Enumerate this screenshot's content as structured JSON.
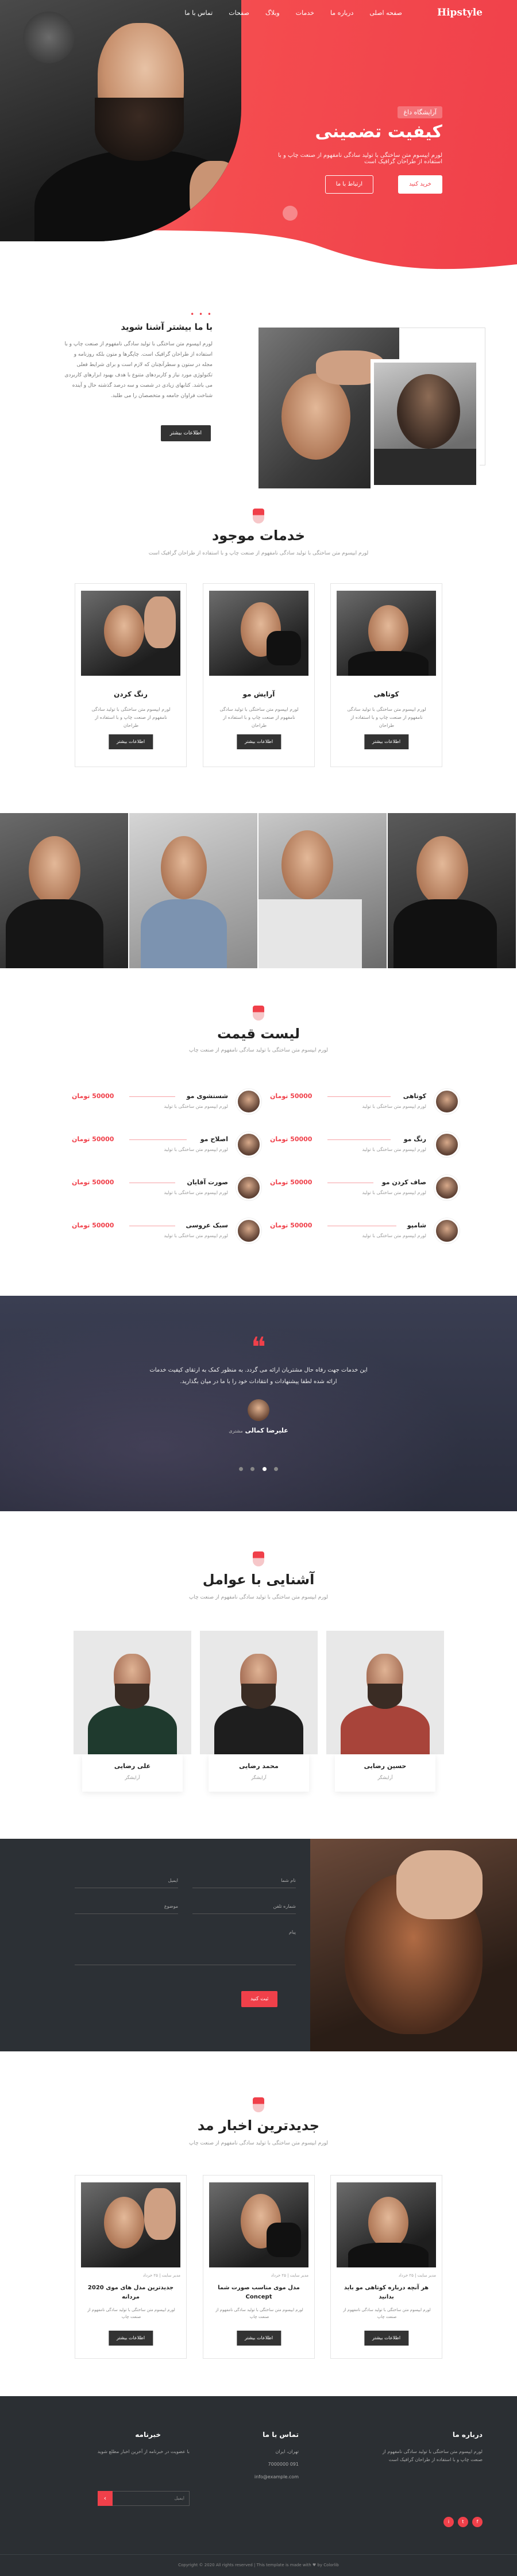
{
  "header": {
    "logo": "Hipstyle",
    "menu": [
      "صفحه اصلی",
      "درباره ما",
      "خدمات",
      "وبلاگ",
      "صفحات",
      "تماس با ما"
    ]
  },
  "hero": {
    "tag": "آرایشگاه داغ",
    "title": "کیفیت تضمینی",
    "subtitle": "لورم ایپسوم متن ساختگی با تولید سادگی نامفهوم از صنعت چاپ و با استفاده از طراحان گرافیک است",
    "button_primary": "خرید کنید",
    "button_secondary": "ارتباط با ما"
  },
  "about": {
    "title": "با ما بیشتر آشنا شوید",
    "text": "لورم ایپسوم متن ساختگی با تولید سادگی نامفهوم از صنعت چاپ و با استفاده از طراحان گرافیک است. چاپگرها و متون بلکه روزنامه و مجله در ستون و سطرآنچنان که لازم است و برای شرایط فعلی تکنولوژی مورد نیاز و کاربردهای متنوع با هدف بهبود ابزارهای کاربردی می باشد. کتابهای زیادی در شصت و سه درصد گذشته حال و آینده شناخت فراوان جامعه و متخصصان را می طلبد.",
    "button": "اطلاعات بیشتر"
  },
  "services": {
    "title": "خدمات موجود",
    "subtitle": "لورم ایپسوم متن ساختگی با تولید سادگی نامفهوم از صنعت چاپ و با استفاده از طراحان گرافیک است",
    "items": [
      {
        "name": "کوتاهی",
        "desc": "لورم ایپسوم متن ساختگی با تولید سادگی نامفهوم از صنعت چاپ و با استفاده از طراحان",
        "button": "اطلاعات بیشتر"
      },
      {
        "name": "آرایش مو",
        "desc": "لورم ایپسوم متن ساختگی با تولید سادگی نامفهوم از صنعت چاپ و با استفاده از طراحان",
        "button": "اطلاعات بیشتر"
      },
      {
        "name": "رنگ کردن",
        "desc": "لورم ایپسوم متن ساختگی با تولید سادگی نامفهوم از صنعت چاپ و با استفاده از طراحان",
        "button": "اطلاعات بیشتر"
      }
    ]
  },
  "prices": {
    "title": "لیست قیمت",
    "subtitle": "لورم ایپسوم متن ساختگی با تولید سادگی نامفهوم از صنعت چاپ",
    "right": [
      {
        "name": "کوتاهی",
        "price": "50000 تومان",
        "desc": "لورم ایپسوم متن ساختگی با تولید"
      },
      {
        "name": "رنگ مو",
        "price": "50000 تومان",
        "desc": "لورم ایپسوم متن ساختگی با تولید"
      },
      {
        "name": "صاف کردن مو",
        "price": "50000 تومان",
        "desc": "لورم ایپسوم متن ساختگی با تولید"
      },
      {
        "name": "شامپو",
        "price": "50000 تومان",
        "desc": "لورم ایپسوم متن ساختگی با تولید"
      }
    ],
    "left": [
      {
        "name": "شستشوی مو",
        "price": "50000 تومان",
        "desc": "لورم ایپسوم متن ساختگی با تولید"
      },
      {
        "name": "اصلاح مو",
        "price": "50000 تومان",
        "desc": "لورم ایپسوم متن ساختگی با تولید"
      },
      {
        "name": "صورت آقایان",
        "price": "50000 تومان",
        "desc": "لورم ایپسوم متن ساختگی با تولید"
      },
      {
        "name": "سبک عروسی",
        "price": "50000 تومان",
        "desc": "لورم ایپسوم متن ساختگی با تولید"
      }
    ]
  },
  "testimonial": {
    "quote_mark": "❝",
    "text": "این خدمات جهت رفاه حال مشتریان ارائه می گردد. به منظور کمک به ارتقای کیفیت خدمات ارائه شده لطفا پیشنهادات و انتقادات خود را با ما در میان بگذارید.",
    "name": "علیرضا کمالی",
    "role": "مشتری"
  },
  "team": {
    "title": "آشنایی با عوامل",
    "subtitle": "لورم ایپسوم متن ساختگی با تولید سادگی نامفهوم از صنعت چاپ",
    "members": [
      {
        "name": "حسین رضایی",
        "role": "آرایشگر"
      },
      {
        "name": "محمد رضایی",
        "role": "آرایشگر"
      },
      {
        "name": "علی رضایی",
        "role": "آرایشگر"
      }
    ]
  },
  "contact": {
    "fields": [
      "نام شما",
      "ایمیل",
      "شماره تلفن",
      "موضوع",
      "پیام"
    ],
    "button": "ثبت کنید"
  },
  "news": {
    "title": "جدیدترین اخبار مد",
    "subtitle": "لورم ایپسوم متن ساختگی با تولید سادگی نامفهوم از صنعت چاپ",
    "items": [
      {
        "meta": "مدیر سایت  |  ۲۵ خرداد",
        "title": "هر آنچه درباره کوتاهی مو باید بدانید",
        "desc": "لورم ایپسوم متن ساختگی با تولید سادگی نامفهوم از صنعت چاپ",
        "button": "اطلاعات بیشتر"
      },
      {
        "meta": "مدیر سایت  |  ۲۵ خرداد",
        "title": "مدل موی مناسب صورت شما Concept",
        "desc": "لورم ایپسوم متن ساختگی با تولید سادگی نامفهوم از صنعت چاپ",
        "button": "اطلاعات بیشتر"
      },
      {
        "meta": "مدیر سایت  |  ۲۵ خرداد",
        "title": "جدیدترین مدل های موی 2020 مردانه",
        "desc": "لورم ایپسوم متن ساختگی با تولید سادگی نامفهوم از صنعت چاپ",
        "button": "اطلاعات بیشتر"
      }
    ]
  },
  "footer": {
    "about_title": "درباره ما",
    "about_text": "لورم ایپسوم متن ساختگی با تولید سادگی نامفهوم از صنعت چاپ و با استفاده از طراحان گرافیک است",
    "contact_title": "تماس با ما",
    "address": "تهران، ایران",
    "phone": "091 7000000",
    "email": "info@example.com",
    "newsletter_title": "خبرنامه",
    "newsletter_text": "با عضویت در خبرنامه از آخرین اخبار مطلع شوید",
    "newsletter_placeholder": "ایمیل",
    "newsletter_button": "›",
    "copyright": "Copyright © 2020 All rights reserved | This template is made with ♥ by Colorlib"
  },
  "colors": {
    "accent": "#f0404a",
    "dark": "#2b2f33",
    "text": "#333333"
  }
}
